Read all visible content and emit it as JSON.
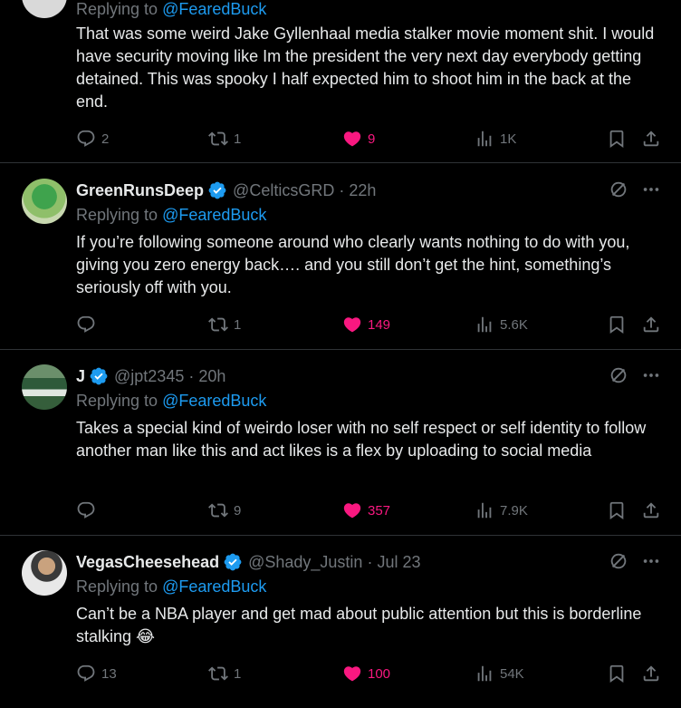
{
  "tweets": [
    {
      "name": "",
      "handle": "",
      "time": "",
      "replying_prefix": "Replying to ",
      "replying_to": "@FearedBuck",
      "text": "That was some weird Jake Gyllenhaal media stalker movie moment shit. I would have security moving like Im the president the very next day everybody getting detained. This was spooky I half expected him to shoot him in the back at the end.",
      "replies": "2",
      "retweets": "1",
      "likes": "9",
      "views": "1K"
    },
    {
      "name": "GreenRunsDeep",
      "handle": "@CelticsGRD",
      "time": "22h",
      "replying_prefix": "Replying to ",
      "replying_to": "@FearedBuck",
      "text": "If you’re following someone around who clearly wants nothing to do with you, giving you zero energy back…. and you still don’t get the hint, something’s seriously off with you.",
      "replies": "",
      "retweets": "1",
      "likes": "149",
      "views": "5.6K"
    },
    {
      "name": "J",
      "handle": "@jpt2345",
      "time": "20h",
      "replying_prefix": "Replying to ",
      "replying_to": "@FearedBuck",
      "text": "Takes a special kind of weirdo loser with no self respect or self identity to follow another man like this and act likes is a flex by uploading to social media",
      "replies": "",
      "retweets": "9",
      "likes": "357",
      "views": "7.9K"
    },
    {
      "name": "VegasCheesehead",
      "handle": "@Shady_Justin",
      "time": "Jul 23",
      "replying_prefix": "Replying to ",
      "replying_to": "@FearedBuck",
      "text": "Can’t be a NBA player and get mad about public attention but this is borderline stalking 😂",
      "replies": "13",
      "retweets": "1",
      "likes": "100",
      "views": "54K"
    }
  ],
  "separator": "·",
  "colors": {
    "background": "#000000",
    "text": "#e7e9ea",
    "muted": "#71767b",
    "link": "#1d9bf0",
    "like": "#f91880",
    "verified": "#1d9bf0",
    "border": "#2f3336"
  },
  "icons": {
    "reply": "reply-icon",
    "retweet": "retweet-icon",
    "like": "heart-icon",
    "views": "views-icon",
    "bookmark": "bookmark-icon",
    "share": "share-icon",
    "grok": "grok-icon",
    "more": "more-icon",
    "verified": "verified-badge-icon"
  }
}
